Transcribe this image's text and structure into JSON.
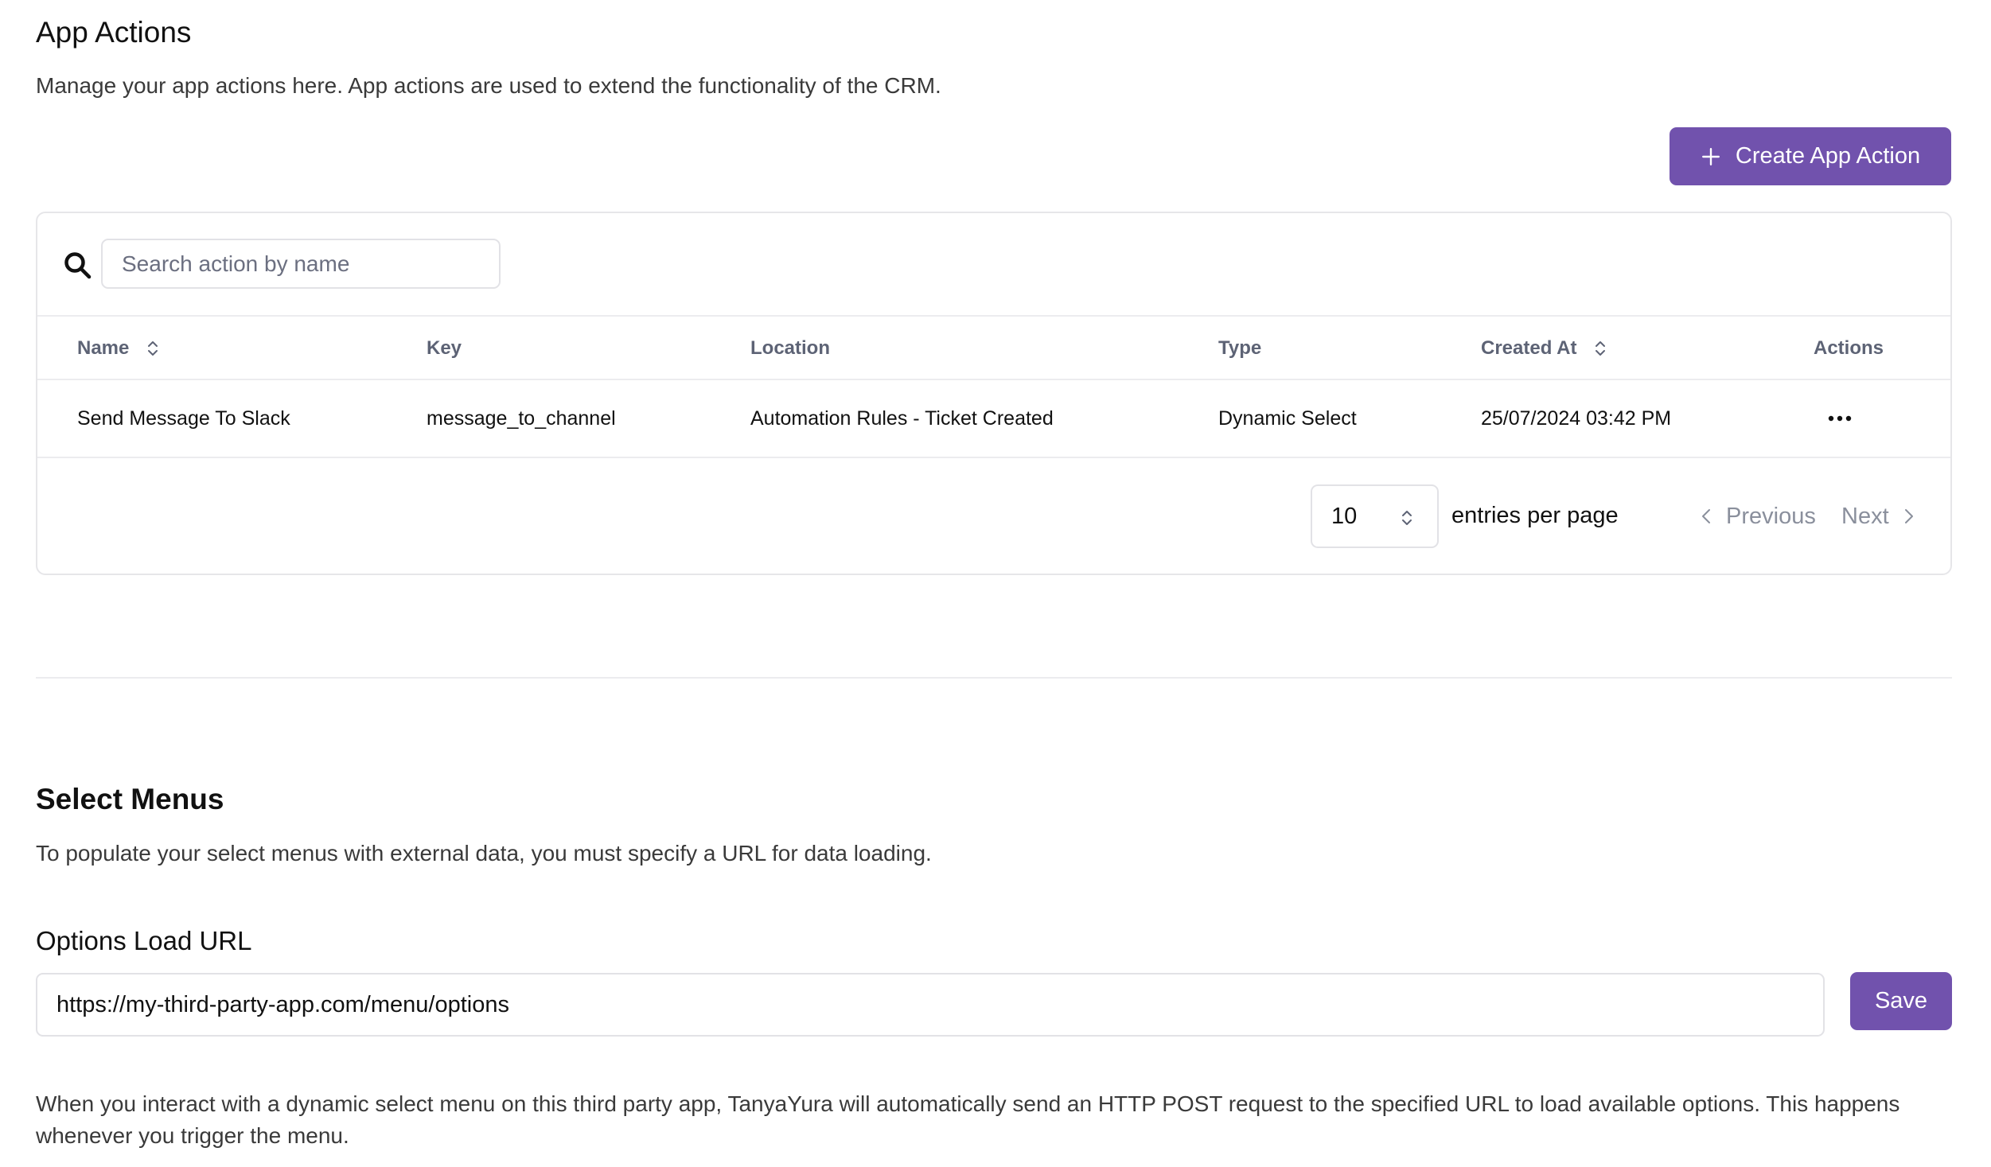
{
  "app_actions": {
    "title": "App Actions",
    "description": "Manage your app actions here. App actions are used to extend the functionality of the CRM.",
    "create_button_label": "Create App Action",
    "search_placeholder": "Search action by name",
    "table": {
      "columns": [
        "Name",
        "Key",
        "Location",
        "Type",
        "Created At",
        "Actions"
      ],
      "rows": [
        {
          "name": "Send Message To Slack",
          "key": "message_to_channel",
          "location": "Automation Rules - Ticket Created",
          "type": "Dynamic Select",
          "created_at": "25/07/2024 03:42 PM"
        }
      ]
    },
    "pagination": {
      "per_page": "10",
      "per_page_label": "entries per page",
      "previous_label": "Previous",
      "next_label": "Next"
    }
  },
  "select_menus": {
    "title": "Select Menus",
    "description": "To populate your select menus with external data, you must specify a URL for data loading.",
    "url_label": "Options Load URL",
    "url_value": "https://my-third-party-app.com/menu/options",
    "save_label": "Save",
    "help_text": "When you interact with a dynamic select menu on this third party app, TanyaYura will automatically send an HTTP POST request to the specified URL to load available options. This happens whenever you trigger the menu."
  },
  "colors": {
    "accent": "#7152ad",
    "border": "#e6e6e9",
    "muted_text": "#5d6375"
  },
  "icons": {
    "create": "plus-icon",
    "search": "search-icon",
    "sort": "sort-icon",
    "row_menu": "more-horizontal-icon",
    "per_page": "chevron-up-down-icon",
    "previous": "chevron-left-icon",
    "next": "chevron-right-icon"
  }
}
